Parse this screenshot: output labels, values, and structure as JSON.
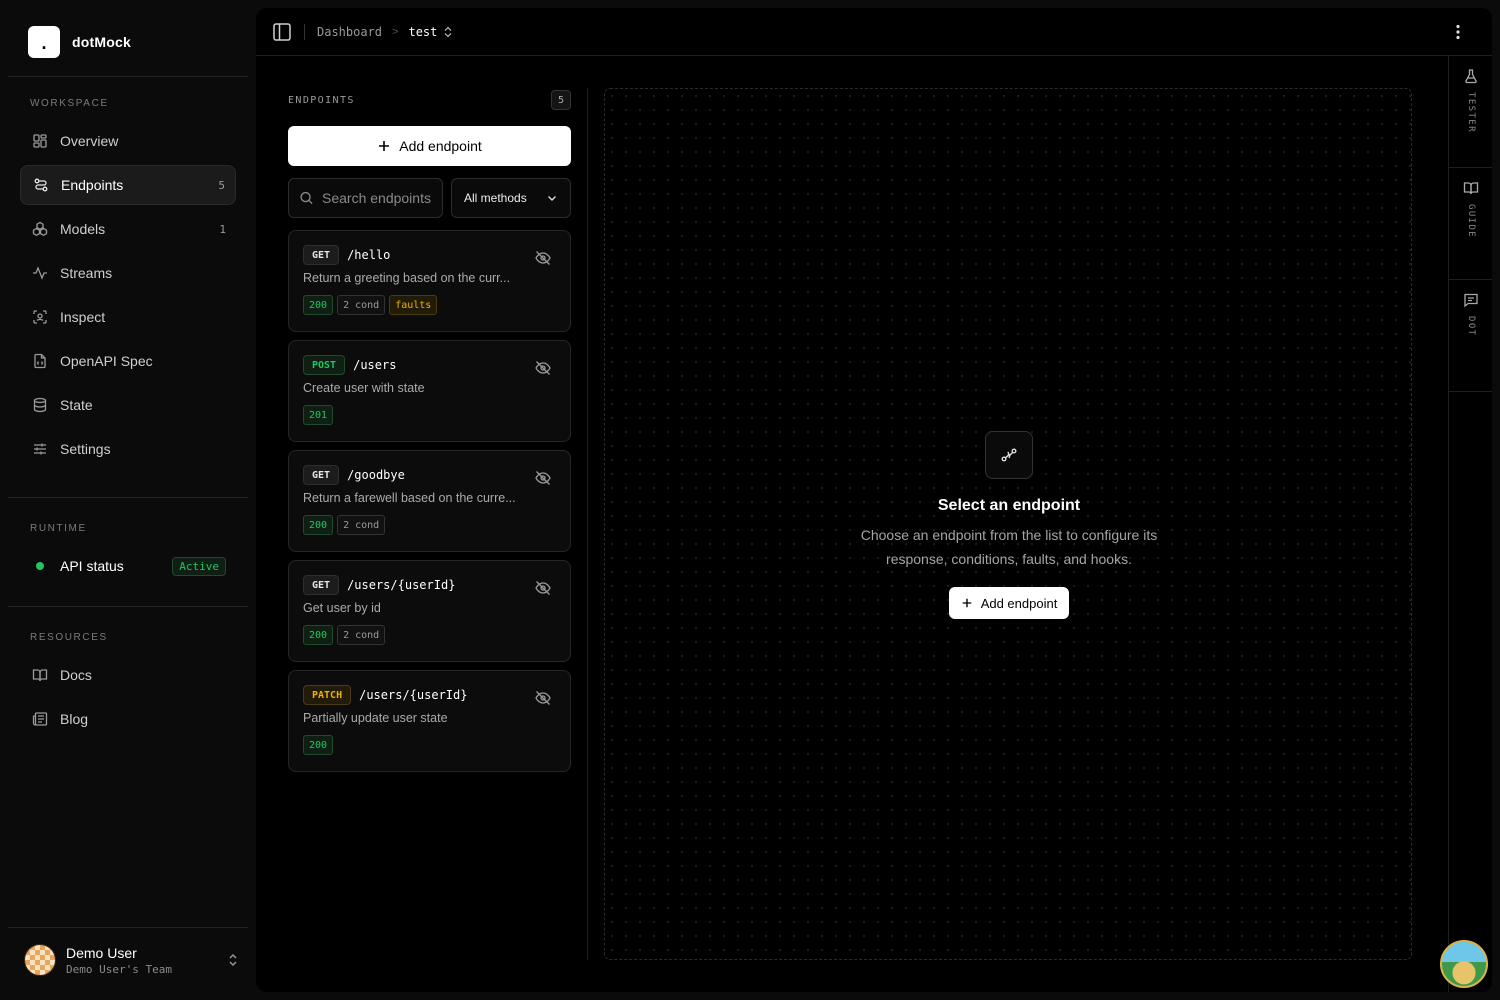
{
  "brand": {
    "logo_char": ".",
    "name": "dotMock"
  },
  "sidebar": {
    "workspace_label": "WORKSPACE",
    "items": [
      {
        "label": "Overview",
        "icon": "grid-icon",
        "count": ""
      },
      {
        "label": "Endpoints",
        "icon": "route-icon",
        "count": "5"
      },
      {
        "label": "Models",
        "icon": "models-icon",
        "count": "1"
      },
      {
        "label": "Streams",
        "icon": "activity-icon",
        "count": ""
      },
      {
        "label": "Inspect",
        "icon": "scan-icon",
        "count": ""
      },
      {
        "label": "OpenAPI Spec",
        "icon": "file-code-icon",
        "count": ""
      },
      {
        "label": "State",
        "icon": "database-icon",
        "count": ""
      },
      {
        "label": "Settings",
        "icon": "sliders-icon",
        "count": ""
      }
    ],
    "runtime_label": "RUNTIME",
    "api_status": {
      "label": "API status",
      "badge": "Active"
    },
    "resources_label": "RESOURCES",
    "resources": [
      {
        "label": "Docs",
        "icon": "book-icon"
      },
      {
        "label": "Blog",
        "icon": "newspaper-icon"
      }
    ],
    "user": {
      "name": "Demo User",
      "team": "Demo User's Team"
    }
  },
  "topbar": {
    "crumb_root": "Dashboard",
    "crumb_sep": ">",
    "crumb_current": "test"
  },
  "endpoints": {
    "title": "ENDPOINTS",
    "count": "5",
    "add_label": "Add endpoint",
    "search_placeholder": "Search endpoints",
    "method_filter": "All methods",
    "list": [
      {
        "method": "GET",
        "path": "/hello",
        "desc": "Return a greeting based on the curr...",
        "tags": [
          "200",
          "2 cond",
          "faults"
        ]
      },
      {
        "method": "POST",
        "path": "/users",
        "desc": "Create user with state",
        "tags": [
          "201"
        ]
      },
      {
        "method": "GET",
        "path": "/goodbye",
        "desc": "Return a farewell based on the curre...",
        "tags": [
          "200",
          "2 cond"
        ]
      },
      {
        "method": "GET",
        "path": "/users/{userId}",
        "desc": "Get user by id",
        "tags": [
          "200",
          "2 cond"
        ]
      },
      {
        "method": "PATCH",
        "path": "/users/{userId}",
        "desc": "Partially update user state",
        "tags": [
          "200"
        ]
      }
    ]
  },
  "empty_state": {
    "title": "Select an endpoint",
    "desc": "Choose an endpoint from the list to configure its response, conditions, faults, and hooks.",
    "button": "Add endpoint"
  },
  "rail": [
    {
      "label": "TESTER",
      "icon": "flask-icon"
    },
    {
      "label": "GUIDE",
      "icon": "book-open-icon"
    },
    {
      "label": "DOT",
      "icon": "message-icon"
    }
  ],
  "colors": {
    "accent_green": "#22c55e",
    "accent_yellow": "#eab308",
    "background": "#000000"
  }
}
